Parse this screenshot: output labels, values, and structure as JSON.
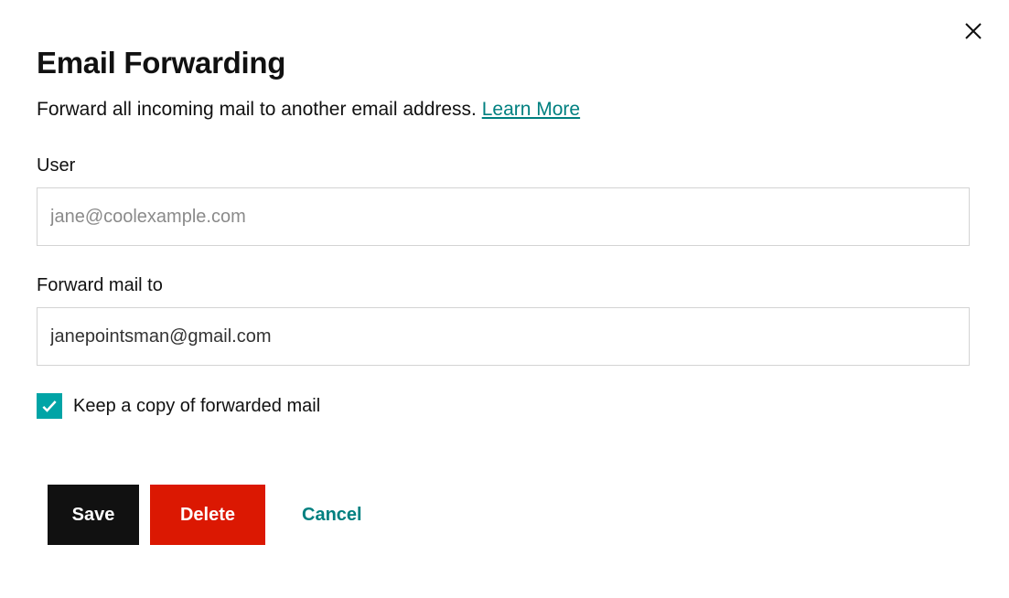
{
  "header": {
    "title": "Email Forwarding",
    "description_text": "Forward all incoming mail to another email address. ",
    "learn_more_label": "Learn More"
  },
  "form": {
    "user": {
      "label": "User",
      "placeholder": "jane@coolexample.com",
      "value": ""
    },
    "forward_to": {
      "label": "Forward mail to",
      "value": "janepointsman@gmail.com"
    },
    "keep_copy": {
      "label": "Keep a copy of forwarded mail",
      "checked": true
    }
  },
  "buttons": {
    "save": "Save",
    "delete": "Delete",
    "cancel": "Cancel"
  },
  "colors": {
    "teal": "#008080",
    "checkbox_teal": "#00a4a6",
    "red": "#db1802",
    "black": "#111111",
    "border": "#d3d3d3",
    "placeholder": "#8a8a8a"
  }
}
